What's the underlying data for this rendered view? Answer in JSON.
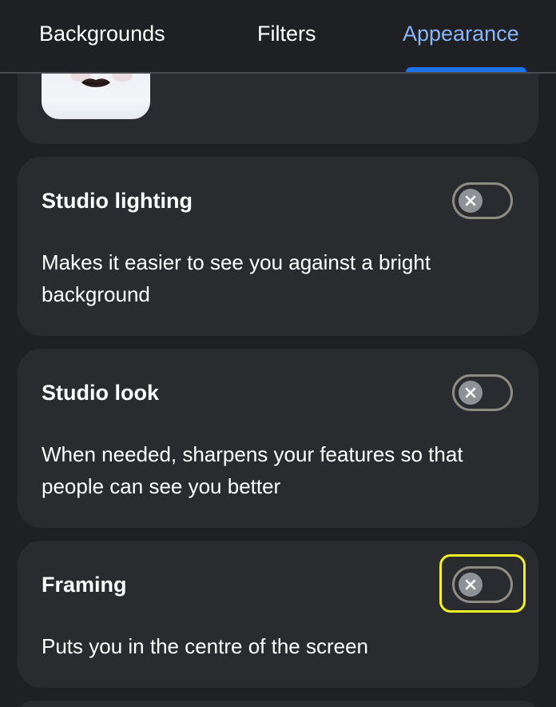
{
  "tabs": [
    {
      "label": "Backgrounds",
      "selected": false
    },
    {
      "label": "Filters",
      "selected": false
    },
    {
      "label": "Appearance",
      "selected": true
    }
  ],
  "colors": {
    "background": "#1f2023",
    "card": "#2a2b2f",
    "selected_tab_text": "#8ab4f8",
    "tab_indicator": "#1a73e8",
    "toggle_border": "#8f8c84",
    "focus_highlight": "#f0f025"
  },
  "settings": [
    {
      "title": "Studio lighting",
      "description": "Makes it easier to see you against a bright background",
      "enabled": false,
      "toggle_icon": "close-icon"
    },
    {
      "title": "Studio look",
      "description": "When needed, sharpens your features so that people can see you better",
      "enabled": false,
      "toggle_icon": "close-icon"
    },
    {
      "title": "Framing",
      "description": "Puts you in the centre of the screen",
      "enabled": false,
      "toggle_icon": "close-icon",
      "focused": true
    }
  ]
}
